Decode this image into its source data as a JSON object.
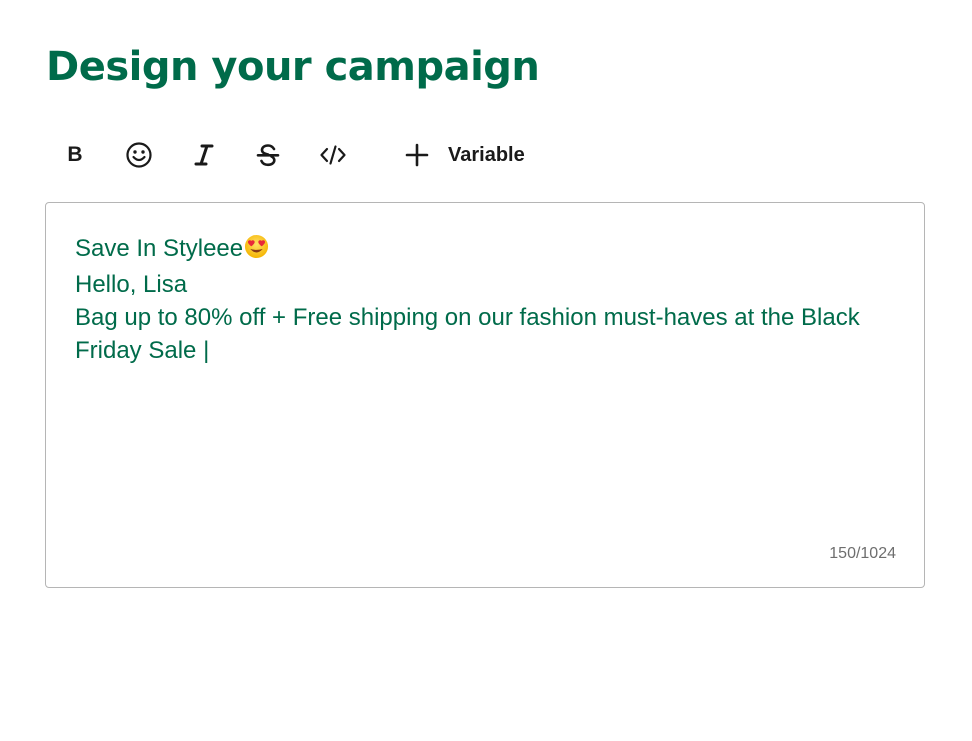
{
  "page": {
    "title": "Design your campaign"
  },
  "toolbar": {
    "bold_label": "B",
    "variable_label": "Variable",
    "icons": [
      "bold-icon",
      "emoji-icon",
      "italic-icon",
      "strikethrough-icon",
      "code-icon",
      "plus-icon"
    ]
  },
  "editor": {
    "lines": [
      "Save In Styleee",
      "Hello, Lisa",
      "Bag up to 80% off + Free shipping on our fashion must-haves at the Black",
      "Friday Sale "
    ],
    "caret": "|",
    "counter": "150/1024"
  },
  "colors": {
    "brand_green": "#006b4a",
    "toolbar_icon": "#1a1a1a",
    "border": "#b5b5b5",
    "counter_text": "#6e6e6e"
  }
}
